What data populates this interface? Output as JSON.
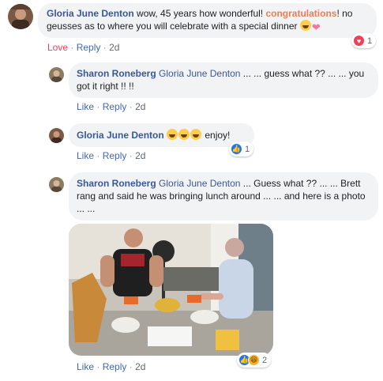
{
  "comments": [
    {
      "author": "Gloria June Denton",
      "text_pre": "wow, 45 years how wonderful! ",
      "highlight": "congratulations",
      "text_post": "! no geusses as to where you will celebrate with a special dinner",
      "action_primary": "Love",
      "action_reply": "Reply",
      "time": "2d",
      "reaction_count": "1",
      "reaction_icon": "love-icon"
    },
    {
      "author": "Sharon Roneberg",
      "tag": "Gloria June Denton",
      "text": " ... ... guess what ?? ... ... you got it right !! !!",
      "action_like": "Like",
      "action_reply": "Reply",
      "time": "2d"
    },
    {
      "author": "Gloria June Denton",
      "text": " enjoy!",
      "action_like": "Like",
      "action_reply": "Reply",
      "time": "2d",
      "reaction_count": "1",
      "reaction_icon": "like-icon"
    },
    {
      "author": "Sharon Roneberg",
      "tag": "Gloria June Denton",
      "text": " ... Guess what ?? ... ... Brett rang and said he was bringing lunch around ... ... and here is a photo ... ...",
      "action_like": "Like",
      "action_reply": "Reply",
      "time": "2d",
      "reaction_count": "2",
      "reaction_icons": [
        "like-icon",
        "haha-icon"
      ]
    }
  ],
  "separator": "·",
  "colors": {
    "link": "#385898",
    "action_link": "#4267b2",
    "love": "#f33e58",
    "highlight": "#ec7d54",
    "bubble": "#f2f3f5"
  }
}
